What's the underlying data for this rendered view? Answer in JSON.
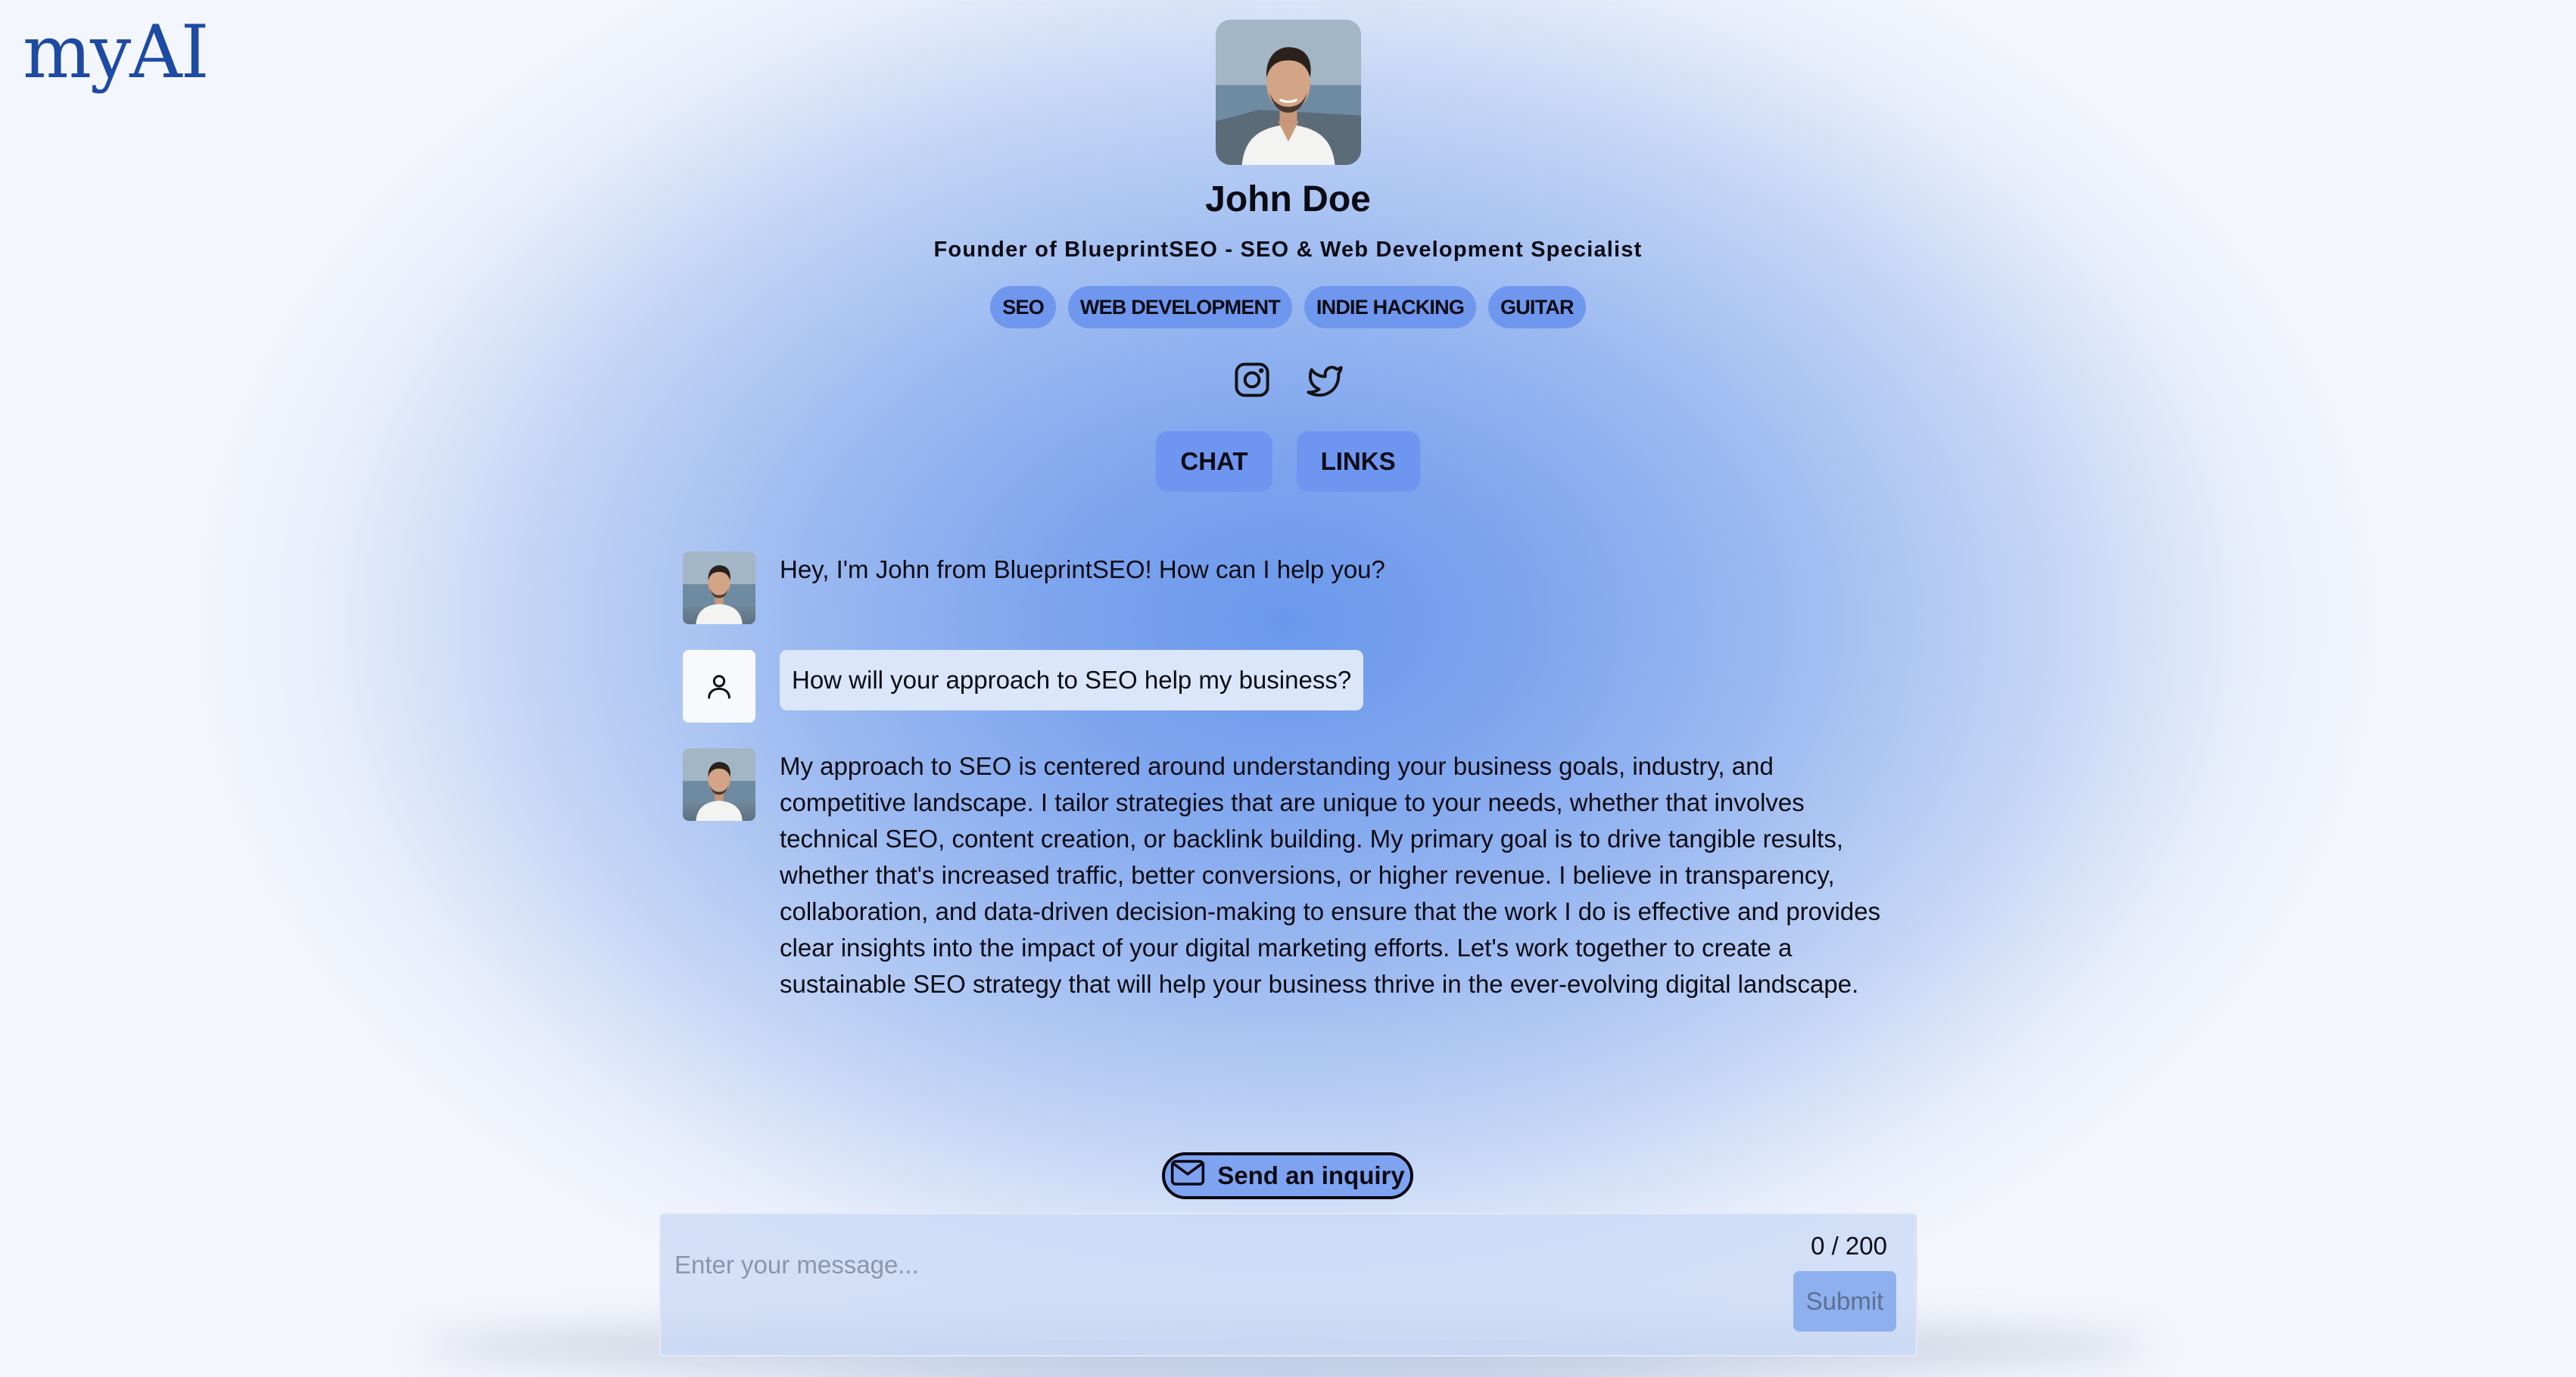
{
  "app": {
    "logo_text": "myAI"
  },
  "profile": {
    "name": "John Doe",
    "tagline": "Founder of BlueprintSEO - SEO & Web Development Specialist",
    "tags": [
      "SEO",
      "WEB DEVELOPMENT",
      "INDIE HACKING",
      "GUITAR"
    ],
    "social_icons": [
      "instagram-icon",
      "twitter-icon"
    ]
  },
  "tabs": [
    {
      "label": "CHAT"
    },
    {
      "label": "LINKS"
    }
  ],
  "chat": {
    "messages": [
      {
        "role": "assistant",
        "text": "Hey, I'm John from BlueprintSEO! How can I help you?"
      },
      {
        "role": "user",
        "text": "How will your approach to SEO help my business?"
      },
      {
        "role": "assistant",
        "text": "My approach to SEO is centered around understanding your business goals, industry, and competitive landscape. I tailor strategies that are unique to your needs, whether that involves technical SEO, content creation, or backlink building. My primary goal is to drive tangible results, whether that's increased traffic, better conversions, or higher revenue. I believe in transparency, collaboration, and data-driven decision-making to ensure that the work I do is effective and provides clear insights into the impact of your digital marketing efforts. Let's work together to create a sustainable SEO strategy that will help your business thrive in the ever-evolving digital landscape."
      }
    ]
  },
  "inquiry": {
    "label": "Send an inquiry",
    "icon": "envelope-icon"
  },
  "composer": {
    "placeholder": "Enter your message...",
    "value": "",
    "counter": "0 / 200",
    "submit_label": "Submit"
  },
  "colors": {
    "accent": "#6f97ee",
    "logo": "#1d4aa3",
    "user_bubble": "#dbe6fb",
    "background_center": "#6a98ec"
  }
}
